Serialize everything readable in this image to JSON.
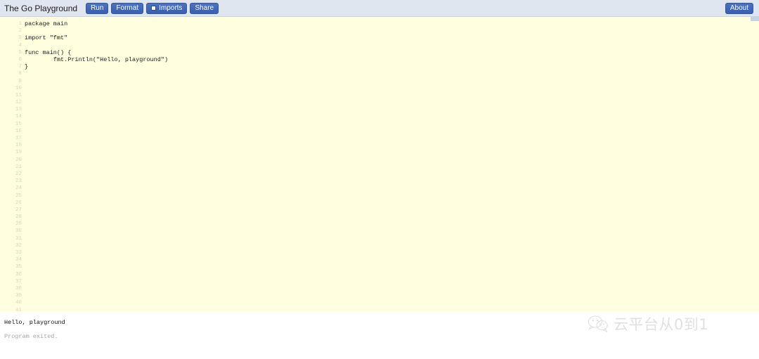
{
  "header": {
    "title": "The Go Playground",
    "buttons": [
      {
        "label": "Run",
        "name": "run-button"
      },
      {
        "label": "Format",
        "name": "format-button"
      },
      {
        "label": "Imports",
        "name": "imports-button",
        "checkbox": true,
        "checked": false
      },
      {
        "label": "Share",
        "name": "share-button"
      }
    ],
    "about_label": "About",
    "background_color": "#e0e6ef",
    "button_color": "#3e66b8"
  },
  "editor": {
    "background_color": "#ffffe0",
    "gutter_color": "#d9d9b8",
    "text_color": "#1c1c1c",
    "first_line": 1,
    "last_line": 41,
    "code_lines": [
      "package main",
      "",
      "import \"fmt\"",
      "",
      "func main() {",
      "\tfmt.Println(\"Hello, playground\")",
      "}"
    ],
    "code": "package main\n\nimport \"fmt\"\n\nfunc main() {\n\tfmt.Println(\"Hello, playground\")\n}"
  },
  "output": {
    "lines": [
      {
        "text": "Hello, playground",
        "kind": "stdout"
      },
      {
        "text": "Program exited.",
        "kind": "system"
      }
    ],
    "stdout_text": "Hello, playground",
    "status_text": "Program exited."
  },
  "watermark": {
    "text": "云平台从0到1",
    "icon": "wechat-icon",
    "color": "#9a9a9a"
  }
}
